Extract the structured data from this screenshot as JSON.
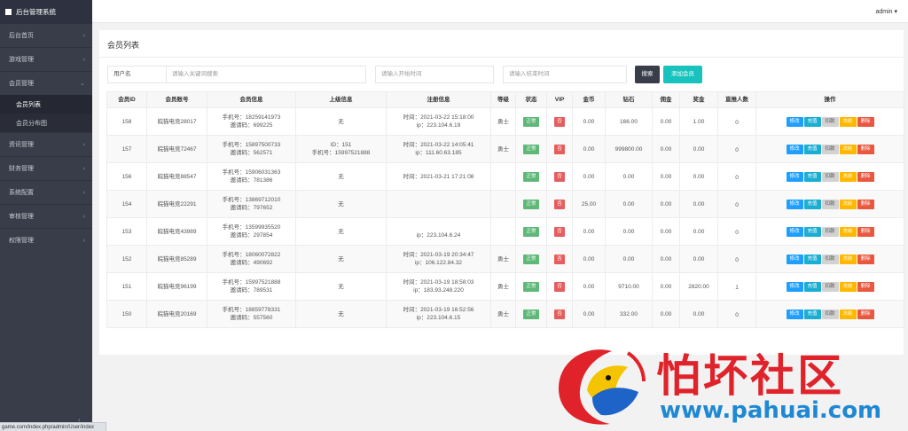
{
  "brand": "后台管理系统",
  "admin_user": "admin",
  "status_url": "game.com/index.php/admin/User/index",
  "sidebar": {
    "items": [
      {
        "label": "后台首页"
      },
      {
        "label": "游戏管理"
      },
      {
        "label": "会员管理",
        "sub": [
          {
            "label": "会员列表"
          },
          {
            "label": "会员分布图"
          }
        ]
      },
      {
        "label": "资讯管理"
      },
      {
        "label": "财务管理"
      },
      {
        "label": "系统配置"
      },
      {
        "label": "审核管理"
      },
      {
        "label": "权限管理"
      }
    ]
  },
  "page_title": "会员列表",
  "search": {
    "username_label": "用户名",
    "keyword_placeholder": "请输入关键词搜索",
    "start_placeholder": "请输入开始时间",
    "end_placeholder": "请输入结束时间",
    "search_button": "搜索",
    "add_button": "添加会员"
  },
  "table": {
    "headers": [
      "会员ID",
      "会员账号",
      "会员信息",
      "上级信息",
      "注册信息",
      "等级",
      "状态",
      "VIP",
      "金币",
      "钻石",
      "佣金",
      "奖金",
      "直推人数",
      "操作"
    ],
    "op_labels": {
      "edit": "修改",
      "recharge": "充值",
      "deduct": "扣款",
      "freeze": "冻结",
      "delete": "删除"
    },
    "rows": [
      {
        "id": "158",
        "account": "皖猫电竞28017",
        "info1": "手机号：18259141973",
        "info2": "邀请码：699225",
        "parent1": "无",
        "parent2": "",
        "reg1": "时间：2021-03-22 15:18:00",
        "reg2": "ip：223.104.6.19",
        "level": "勇士",
        "status": "正常",
        "vip": "否",
        "gold": "0.00",
        "diamond": "166.00",
        "commission": "0.00",
        "bonus": "1.00",
        "direct": "0"
      },
      {
        "id": "157",
        "account": "皖猫电竞72467",
        "info1": "手机号：15897500733",
        "info2": "邀请码：562571",
        "parent1": "ID：151",
        "parent2": "手机号：15997521888",
        "reg1": "时间：2021-03-22 14:05:41",
        "reg2": "ip：111.60.63.185",
        "level": "勇士",
        "status": "正常",
        "vip": "否",
        "gold": "0.00",
        "diamond": "999800.00",
        "commission": "0.00",
        "bonus": "0.00",
        "direct": "0"
      },
      {
        "id": "156",
        "account": "皖猫电竞88547",
        "info1": "手机号：15906031363",
        "info2": "邀请码：781386",
        "parent1": "无",
        "parent2": "",
        "reg1": "时间：2021-03-21 17:21:08",
        "reg2": "",
        "level": "",
        "status": "正常",
        "vip": "否",
        "gold": "0.00",
        "diamond": "0.00",
        "commission": "0.00",
        "bonus": "0.00",
        "direct": "0"
      },
      {
        "id": "154",
        "account": "皖猫电竞22291",
        "info1": "手机号：13869712010",
        "info2": "邀请码：797652",
        "parent1": "无",
        "parent2": "",
        "reg1": "",
        "reg2": "",
        "level": "",
        "status": "正常",
        "vip": "否",
        "gold": "25.00",
        "diamond": "0.00",
        "commission": "0.00",
        "bonus": "0.00",
        "direct": "0"
      },
      {
        "id": "153",
        "account": "皖猫电竞43989",
        "info1": "手机号：13599935520",
        "info2": "邀请码：297854",
        "parent1": "无",
        "parent2": "",
        "reg1": "",
        "reg2": "ip：223.104.6.24",
        "level": "",
        "status": "正常",
        "vip": "否",
        "gold": "0.00",
        "diamond": "0.00",
        "commission": "0.00",
        "bonus": "0.00",
        "direct": "0"
      },
      {
        "id": "152",
        "account": "皖猫电竞85289",
        "info1": "手机号：18060072822",
        "info2": "邀请码：490692",
        "parent1": "无",
        "parent2": "",
        "reg1": "时间：2021-03-19 20:34:47",
        "reg2": "ip：106.122.84.32",
        "level": "勇士",
        "status": "正常",
        "vip": "否",
        "gold": "0.00",
        "diamond": "0.00",
        "commission": "0.00",
        "bonus": "0.00",
        "direct": "0"
      },
      {
        "id": "151",
        "account": "皖猫电竞96199",
        "info1": "手机号：15997521888",
        "info2": "邀请码：789531",
        "parent1": "无",
        "parent2": "",
        "reg1": "时间：2021-03-19 18:58:03",
        "reg2": "ip：183.93.248.220",
        "level": "勇士",
        "status": "正常",
        "vip": "否",
        "gold": "0.00",
        "diamond": "9710.00",
        "commission": "0.00",
        "bonus": "2820.00",
        "direct": "1"
      },
      {
        "id": "150",
        "account": "皖猫电竞20169",
        "info1": "手机号：18859778331",
        "info2": "邀请码：557560",
        "parent1": "无",
        "parent2": "",
        "reg1": "时间：2021-03-19 16:52:56",
        "reg2": "ip：223.104.6.15",
        "level": "勇士",
        "status": "正常",
        "vip": "否",
        "gold": "0.00",
        "diamond": "332.00",
        "commission": "0.00",
        "bonus": "0.00",
        "direct": "0"
      }
    ]
  },
  "watermark": {
    "title": "怕坏社区",
    "url": "www.pahuai.com"
  },
  "colors": {
    "sidebar": "#393d49",
    "accent": "#18c3be",
    "normal": "#5fb878",
    "danger": "#e55d5d",
    "watermark_red": "#e0232a",
    "watermark_blue": "#1e88d3"
  }
}
